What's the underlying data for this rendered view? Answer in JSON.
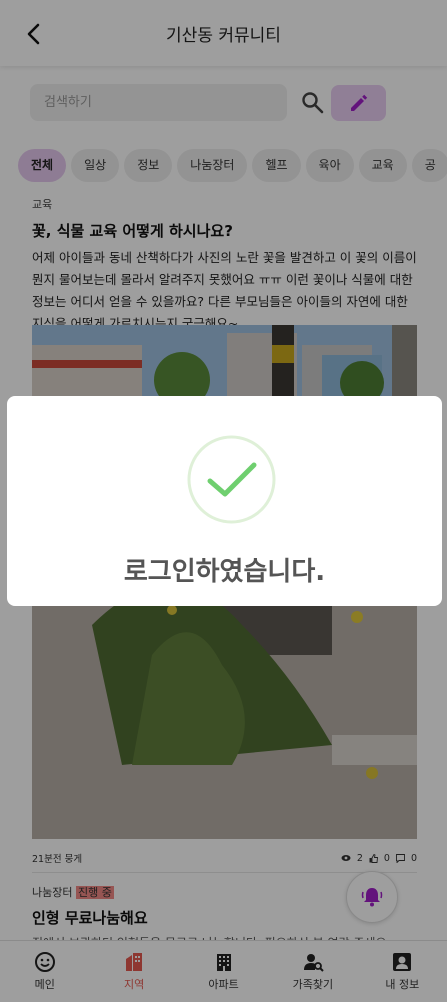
{
  "header": {
    "title": "기산동 커뮤니티"
  },
  "search": {
    "placeholder": "검색하기"
  },
  "tabs": [
    {
      "label": "전체",
      "active": true
    },
    {
      "label": "일상"
    },
    {
      "label": "정보"
    },
    {
      "label": "나눔장터"
    },
    {
      "label": "헬프"
    },
    {
      "label": "육아"
    },
    {
      "label": "교육"
    },
    {
      "label": "공"
    }
  ],
  "post1": {
    "category": "교육",
    "title": "꽃, 식물 교육 어떻게 하시나요?",
    "body": "어제 아이들과 동네 산책하다가 사진의 노란 꽃을 발견하고 이 꽃의 이름이 뭔지 물어보는데 몰라서 알려주지 못했어요 ㅠㅠ 이런 꽃이나 식물에 대한 정보는 어디서 얻을 수 있을까요? 다른 부모님들은 아이들의 자연에 대한 지식을 어떻게 가르치시는지 궁금해요~",
    "meta": "21분전  뭉게",
    "views": "2",
    "likes": "0",
    "comments": "0"
  },
  "post2": {
    "category": "나눔장터",
    "badge": "진행 중",
    "title": "인형 무료나눔해요",
    "body": "집에서 보관하던 인형들을 무료로 나눔합니다. 필요하신 분 연락 주세요."
  },
  "bottom_nav": [
    {
      "label": "메인",
      "icon": "smile-icon"
    },
    {
      "label": "지역",
      "icon": "building-icon",
      "active": true
    },
    {
      "label": "아파트",
      "icon": "apartment-icon"
    },
    {
      "label": "가족찾기",
      "icon": "person-search-icon"
    },
    {
      "label": "내 정보",
      "icon": "profile-icon"
    }
  ],
  "modal": {
    "message": "로그인하였습니다."
  },
  "colors": {
    "accent": "#a020c8",
    "accent_light": "#e6c8ef",
    "active_nav": "#e65a50",
    "check": "#6fcf6f"
  }
}
